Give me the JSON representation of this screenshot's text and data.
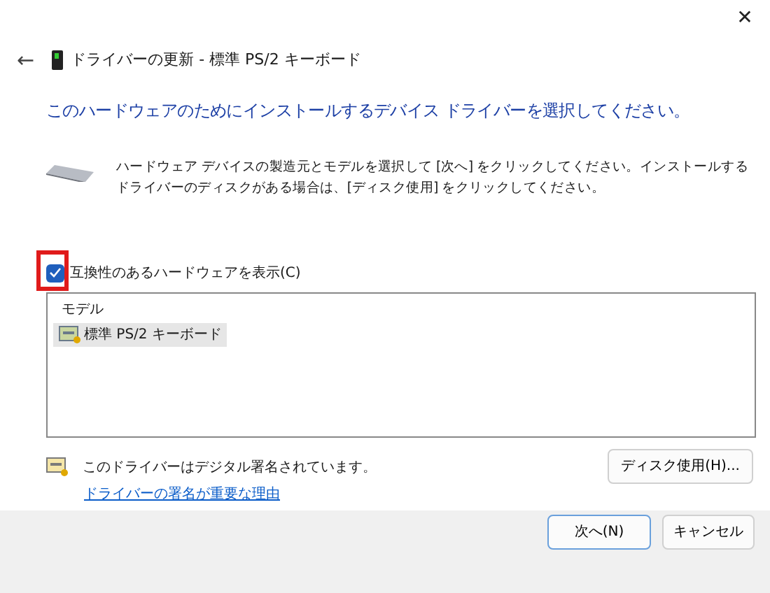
{
  "window": {
    "close": "✕",
    "back": "←",
    "title": "ドライバーの更新 - 標準 PS/2 キーボード"
  },
  "heading": "このハードウェアのためにインストールするデバイス ドライバーを選択してください。",
  "description": "ハードウェア デバイスの製造元とモデルを選択して [次へ] をクリックしてください。インストールするドライバーのディスクがある場合は、[ディスク使用] をクリックしてください。",
  "compatible_checkbox": {
    "label": "互換性のあるハードウェアを表示(C)",
    "checked": true,
    "highlighted": true
  },
  "model_list": {
    "column": "モデル",
    "items": [
      {
        "label": "標準 PS/2 キーボード",
        "selected": true
      }
    ]
  },
  "signature": {
    "text": "このドライバーはデジタル署名されています。",
    "link": "ドライバーの署名が重要な理由"
  },
  "disk_button": "ディスク使用(H)...",
  "buttons": [
    {
      "label": "次へ(N)",
      "default": true
    },
    {
      "label": "キャンセル",
      "default": false
    }
  ]
}
